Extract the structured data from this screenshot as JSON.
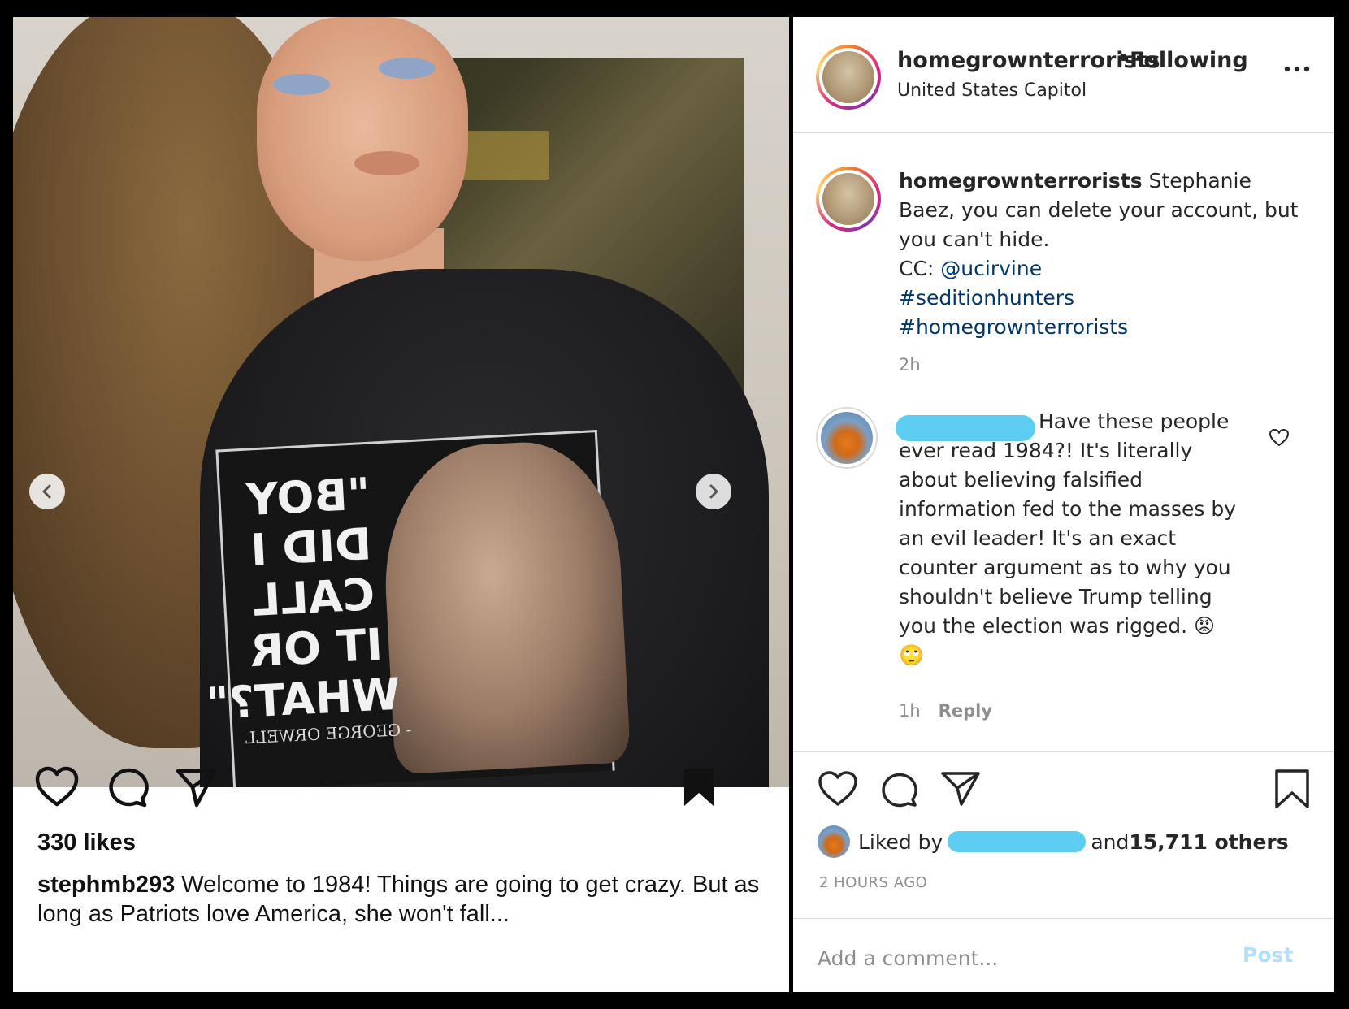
{
  "left_post": {
    "shirt_text": "\"BOY DID I CALL IT OR WHAT?\"",
    "shirt_signature": "- GEORGE ORWELL",
    "likes": "330 likes",
    "caption_user": "stephmb293",
    "caption_text": " Welcome to 1984! Things are going to get crazy. But as long as Patriots love America, she won't fall..."
  },
  "header": {
    "username": "homegrownterrorists",
    "dot": "•",
    "follow_status": "Following",
    "location": "United States Capitol"
  },
  "caption": {
    "username": "homegrownterrorists",
    "text": " Stephanie Baez, you can delete your account, but you can't hide.",
    "cc_prefix": "CC: ",
    "mention": "@ucirvine",
    "hashtags": [
      "#seditionhunters",
      "#homegrownterrorists"
    ],
    "time": "2h"
  },
  "comment": {
    "text": "Have these people ever read 1984?! It's literally about believing falsified information fed to the masses by an evil leader! It's an exact counter argument as to why you shouldn't believe Trump telling you the election was rigged. 😡 🙄",
    "time": "1h",
    "reply_label": "Reply"
  },
  "likes": {
    "prefix": "Liked by",
    "suffix_and": "and ",
    "count": "15,711 others",
    "timestamp": "2 HOURS AGO"
  },
  "add_comment": {
    "placeholder": "Add a comment...",
    "post_label": "Post"
  },
  "colors": {
    "link": "#00376b",
    "redaction": "#5ecdf2",
    "muted": "#8e8e8e",
    "post_disabled": "#b2dffc"
  },
  "icons": [
    "chevron-left-icon",
    "chevron-right-icon",
    "heart-icon",
    "comment-icon",
    "share-icon",
    "bookmark-icon",
    "more-icon"
  ]
}
